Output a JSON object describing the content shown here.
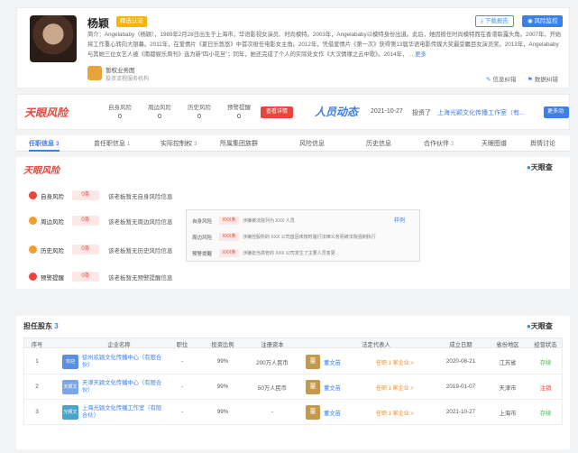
{
  "profile": {
    "name": "杨颖",
    "vip_tag": "精选认证",
    "download_btn": "下载报告",
    "risk_btn": "风险监控",
    "bio": "简介：Angelababy（杨颖），1989年2月28日出生于上海市，华语影视女演员、时尚模特。2003年，Angelababy以模特身份出道。此后，她因担任时尚模特而在香港崭露头角。2007年，开始将工作重心转向大银幕。2011年，在爱情片《夏日乐悠悠》中首次担任电影女主角。2012年，凭借爱情片《第一次》获得第13届华语电影传媒大奖最受瞩目女演员奖。2013年，Angelababy与其她三位女艺人被《南都娱乐周刊》选为新“四小花旦”；同年，她还完成了个人的实际处女作《大汉情缘之云中歌》。2014年，",
    "bio_more": "…更多",
    "claim_line1": "暂权业务图",
    "claim_line2": "投资流程服务机构",
    "action_info": "信息纠错",
    "action_data": "数据纠错"
  },
  "risk": {
    "logo": "天眼风险",
    "cells": [
      {
        "label": "自身风险",
        "value": "0"
      },
      {
        "label": "周边风险",
        "value": "0"
      },
      {
        "label": "历史风险",
        "value": "0"
      },
      {
        "label": "预警提醒",
        "value": "0"
      }
    ],
    "view_btn": "查看详情",
    "people_logo": "人员动态",
    "dyn_date": "2021-10-27",
    "dyn_text": "投资了",
    "dyn_link": "上海光颖文化传播工作室（有...",
    "more_btn": "更多动态"
  },
  "tabs": [
    {
      "label": "任职信息",
      "count": "3"
    },
    {
      "label": "曾任职信息",
      "count": "1"
    },
    {
      "label": "实际控制权",
      "count": "3"
    },
    {
      "label": "所属集团族群",
      "count": ""
    },
    {
      "label": "风险信息",
      "count": ""
    },
    {
      "label": "历史信息",
      "count": ""
    },
    {
      "label": "合作伙伴",
      "count": "2"
    },
    {
      "label": "天眼图谱",
      "count": ""
    },
    {
      "label": "舆情讨论",
      "count": ""
    }
  ],
  "risk_panel": {
    "logo": "天眼风险",
    "brand": "天眼查",
    "rows": [
      {
        "label": "自身风险",
        "badge": "0条",
        "desc": "该老板暂无自身风险信息"
      },
      {
        "label": "周边风险",
        "badge": "0条",
        "desc": "该老板暂无周边风险信息"
      },
      {
        "label": "历史风险",
        "badge": "0条",
        "desc": "该老板暂无历史风险信息"
      },
      {
        "label": "预警提醒",
        "badge": "0条",
        "desc": "该老板暂无预警提醒信息"
      }
    ],
    "sample": {
      "tag": "样例",
      "lines": [
        {
          "k": "自身风险",
          "b": "XXX条",
          "d": "涉嫌被法院列为 XXX 人员"
        },
        {
          "k": "周边风险",
          "b": "XXX条",
          "d": "涉嫌控股所的 XXX 公司首因未按时履行法律义务而被法院强制执行"
        },
        {
          "k": "预警提醒",
          "b": "XXX条",
          "d": "涉嫌担当高管的 XXX 公司发生了主要人员变更"
        }
      ]
    }
  },
  "shareholders": {
    "title": "担任股东",
    "count": "3",
    "brand": "天眼查",
    "headers": [
      "序号",
      "企业名称",
      "职位",
      "投资比例",
      "注册资本",
      "法定代表人",
      "成立日期",
      "省份地区",
      "经营状态"
    ],
    "rows": [
      {
        "no": "1",
        "logo": "欢迎",
        "name": "徐州欢颖文化传播中心（有限合伙）",
        "role": "-",
        "ratio": "99%",
        "capital": "200万人民币",
        "legal_ic": "董",
        "legal": "董文苗",
        "legal_rel": "任职 1 家企业 >",
        "date": "2020-08-21",
        "region": "江苏省",
        "status": "存续"
      },
      {
        "no": "2",
        "logo": "天颖文化",
        "name": "天津天颖文化传播中心（有限合伙）",
        "role": "-",
        "ratio": "99%",
        "capital": "50万人民币",
        "legal_ic": "董",
        "legal": "董文苗",
        "legal_rel": "任职 1 家企业 >",
        "date": "2019-01-07",
        "region": "天津市",
        "status": "注销"
      },
      {
        "no": "3",
        "logo": "光颖文化",
        "name": "上海光颖文化传播工作室（有限合伙）",
        "role": "-",
        "ratio": "99%",
        "capital": "-",
        "legal_ic": "董",
        "legal": "董文苗",
        "legal_rel": "任职 1 家企业 >",
        "date": "2021-10-27",
        "region": "上海市",
        "status": "存续"
      }
    ]
  },
  "colors": {
    "accent": "#3c7fe6",
    "risk_red": "#e6463b",
    "vip_gold": "#f7b500"
  }
}
